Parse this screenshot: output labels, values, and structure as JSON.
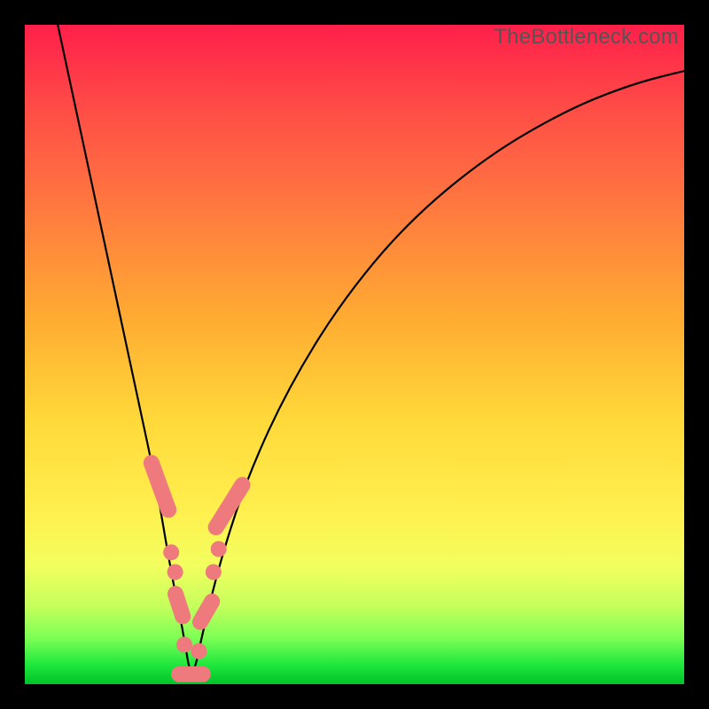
{
  "watermark": {
    "text": "TheBottleneck.com"
  },
  "colors": {
    "marker": "#ef7a7d",
    "curve": "#000000",
    "frame": "#000000",
    "gradient_stops": [
      "#ff1f4a",
      "#ff7a3f",
      "#ffd93a",
      "#f2ff5f",
      "#20e83e"
    ]
  },
  "chart_data": {
    "type": "line",
    "title": "",
    "xlabel": "",
    "ylabel": "",
    "xlim": [
      0,
      100
    ],
    "ylim": [
      0,
      100
    ],
    "grid": false,
    "legend": false,
    "series": [
      {
        "name": "bottleneck-curve",
        "x": [
          5,
          8,
          11,
          14,
          17,
          20,
          22,
          24,
          25.3,
          27,
          30,
          34,
          40,
          48,
          58,
          70,
          82,
          92,
          100
        ],
        "y": [
          100,
          86,
          72,
          58,
          44,
          30,
          18,
          8,
          0,
          8,
          20,
          32,
          45,
          58,
          70,
          80,
          87,
          91,
          93
        ]
      }
    ],
    "markers": [
      {
        "shape": "pill",
        "x": 20.5,
        "y": 30,
        "len": 10,
        "angle": 70
      },
      {
        "shape": "circle",
        "x": 22.2,
        "y": 20,
        "r": 1.3
      },
      {
        "shape": "circle",
        "x": 22.8,
        "y": 17,
        "r": 1.3
      },
      {
        "shape": "pill",
        "x": 23.4,
        "y": 12,
        "len": 6,
        "angle": 72
      },
      {
        "shape": "circle",
        "x": 24.2,
        "y": 6,
        "r": 1.3
      },
      {
        "shape": "pill",
        "x": 25.2,
        "y": 1.5,
        "len": 6,
        "angle": 0
      },
      {
        "shape": "circle",
        "x": 26.4,
        "y": 5,
        "r": 1.3
      },
      {
        "shape": "pill",
        "x": 27.5,
        "y": 11,
        "len": 6,
        "angle": -60
      },
      {
        "shape": "circle",
        "x": 28.6,
        "y": 17,
        "r": 1.3
      },
      {
        "shape": "circle",
        "x": 29.4,
        "y": 20.5,
        "r": 1.3
      },
      {
        "shape": "pill",
        "x": 31.0,
        "y": 27,
        "len": 10,
        "angle": -58
      }
    ]
  }
}
